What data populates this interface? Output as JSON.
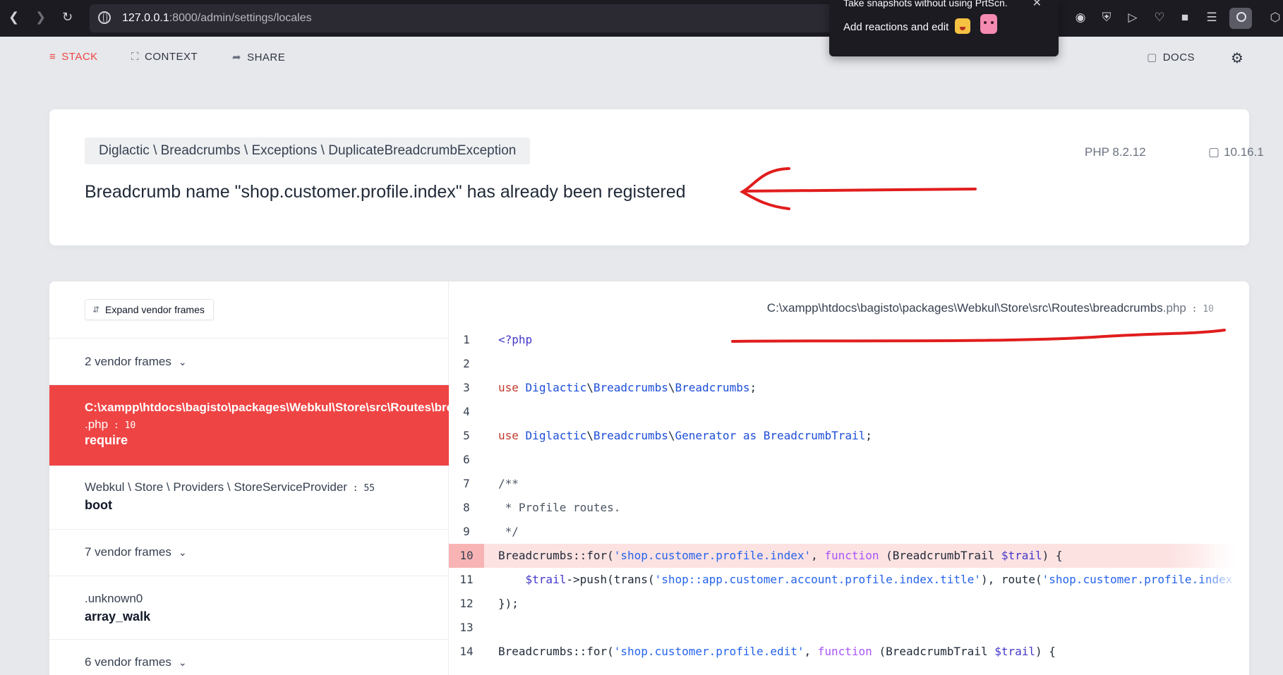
{
  "browser": {
    "url_host": "127.0.0.1",
    "url_rest": ":8000/admin/settings/locales",
    "popup_line1": "Take snapshots without using PrtScn.",
    "popup_line2": "Add reactions and edit"
  },
  "toolbar": {
    "stack": "STACK",
    "context": "CONTEXT",
    "share": "SHARE",
    "docs": "DOCS"
  },
  "error": {
    "exception_class": "Diglactic \\ Breadcrumbs \\ Exceptions \\ DuplicateBreadcrumbException",
    "message": "Breadcrumb name \"shop.customer.profile.index\" has already been registered",
    "php_version": "PHP 8.2.12",
    "laravel_version": "10.16.1"
  },
  "frames": {
    "expand_label": "Expand vendor frames",
    "vendor_2": "2 vendor frames",
    "active_file": "C:\\xampp\\htdocs\\bagisto\\packages\\Webkul\\Store\\src\\Routes\\breadcrumbs",
    "active_ext": ".php",
    "active_line": "10",
    "active_fn": "require",
    "f2_file": "Webkul \\ Store \\ Providers \\ StoreServiceProvider",
    "f2_line": "55",
    "f2_fn": "boot",
    "vendor_7": "7 vendor frames",
    "f3_file": ".unknown0",
    "f3_fn": "array_walk",
    "vendor_6": "6 vendor frames"
  },
  "code": {
    "path": "C:\\xampp\\htdocs\\bagisto\\packages\\Webkul\\Store\\src\\Routes\\breadcrumbs",
    "ext": ".php",
    "line": "10",
    "highlighted_line": 10,
    "lines": [
      {
        "n": "1"
      },
      {
        "n": "2"
      },
      {
        "n": "3"
      },
      {
        "n": "4"
      },
      {
        "n": "5"
      },
      {
        "n": "6"
      },
      {
        "n": "7"
      },
      {
        "n": "8"
      },
      {
        "n": "9"
      },
      {
        "n": "10"
      },
      {
        "n": "11"
      },
      {
        "n": "12"
      },
      {
        "n": "13"
      },
      {
        "n": "14"
      }
    ],
    "l1": "<?php",
    "use": "use",
    "ns1": "Diglactic",
    "ns2": "Breadcrumbs",
    "ns3": "Breadcrumbs",
    "ns4": "Generator",
    "as": "as",
    "alias": "BreadcrumbTrail",
    "c1": "/**",
    "c2": " * Profile routes.",
    "c3": " */",
    "bc": "Breadcrumbs::for(",
    "s10": "'shop.customer.profile.index'",
    "fnkw": "function",
    "trailtype": " (BreadcrumbTrail ",
    "trailvar": "$trail",
    "brace": ") {",
    "l11a": "$trail",
    "l11b": "->push(trans(",
    "s11": "'shop::app.customer.account.profile.index.title'",
    "l11c": "), route(",
    "s11b": "'shop.customer.profile.index",
    "l12": "});",
    "s14": "'shop.customer.profile.edit'"
  }
}
